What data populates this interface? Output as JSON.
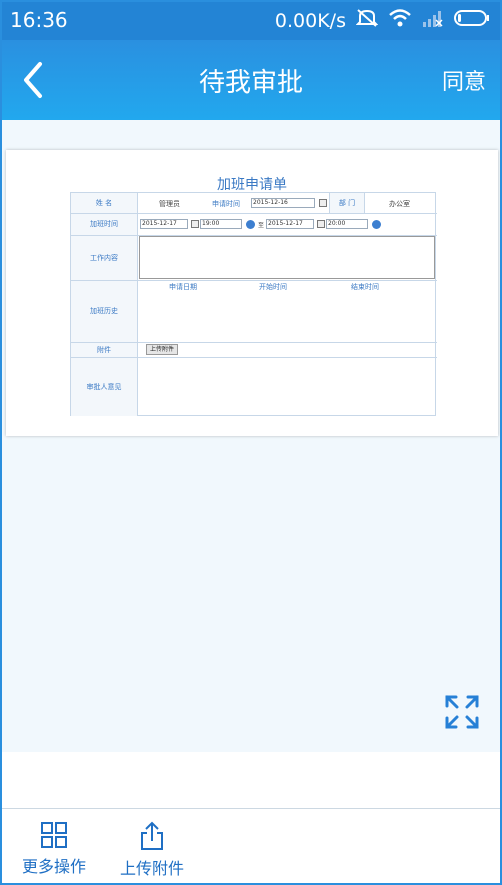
{
  "status_bar": {
    "time": "16:36",
    "network_speed": "0.00K/s",
    "icons": [
      "mute-icon",
      "wifi-icon",
      "signal-icon",
      "battery-icon"
    ]
  },
  "header": {
    "title": "待我审批",
    "back_icon": "chevron-left-icon",
    "action_label": "同意"
  },
  "form": {
    "title": "加班申请单",
    "name_label": "姓 名",
    "name_value": "管理员",
    "apply_time_label": "申请时间",
    "apply_time_value": "2015-12-16",
    "dept_label": "部 门",
    "dept_value": "办公室",
    "overtime_label": "加班时间",
    "start_date": "2015-12-17",
    "start_time": "19:00",
    "to_label": "至",
    "end_date": "2015-12-17",
    "end_time": "20:00",
    "work_content_label": "工作内容",
    "history_label": "加班历史",
    "history_columns": [
      "申请日期",
      "开始时间",
      "结束时间"
    ],
    "attachment_label": "附件",
    "upload_button": "上传附件",
    "approver_opinion_label": "审批人意见"
  },
  "content": {
    "expand_icon": "expand-icon"
  },
  "bottom_bar": {
    "more_actions_label": "更多操作",
    "more_actions_icon": "grid-icon",
    "upload_label": "上传附件",
    "upload_icon": "share-upload-icon"
  },
  "colors": {
    "status_bar": "#2384d5",
    "header": "#2a9ae6",
    "accent": "#1f6fc4",
    "form_text": "#3a79c4"
  }
}
